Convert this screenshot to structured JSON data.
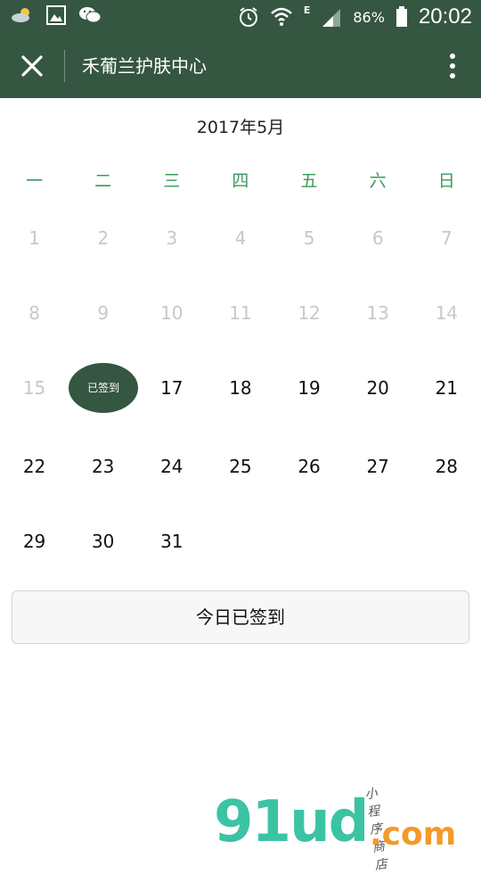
{
  "status_bar": {
    "battery_pct": "86%",
    "network_letter": "E",
    "time": "20:02",
    "icons": [
      "weather-icon",
      "gallery-icon",
      "wechat-icon",
      "alarm-icon",
      "wifi-icon",
      "signal-icon",
      "battery-icon"
    ]
  },
  "nav": {
    "title": "禾葡兰护肤中心",
    "icons": [
      "close-icon",
      "more-vertical-icon"
    ],
    "colors": {
      "bar": "#355641"
    }
  },
  "calendar": {
    "title": "2017年5月",
    "weekdays": [
      "一",
      "二",
      "三",
      "四",
      "五",
      "六",
      "日"
    ],
    "rows": [
      [
        {
          "d": "1",
          "past": true
        },
        {
          "d": "2",
          "past": true
        },
        {
          "d": "3",
          "past": true
        },
        {
          "d": "4",
          "past": true
        },
        {
          "d": "5",
          "past": true
        },
        {
          "d": "6",
          "past": true
        },
        {
          "d": "7",
          "past": true
        }
      ],
      [
        {
          "d": "8",
          "past": true
        },
        {
          "d": "9",
          "past": true
        },
        {
          "d": "10",
          "past": true
        },
        {
          "d": "11",
          "past": true
        },
        {
          "d": "12",
          "past": true
        },
        {
          "d": "13",
          "past": true
        },
        {
          "d": "14",
          "past": true
        }
      ],
      [
        {
          "d": "15",
          "past": true
        },
        {
          "d": "已签到",
          "signed": true
        },
        {
          "d": "17"
        },
        {
          "d": "18"
        },
        {
          "d": "19"
        },
        {
          "d": "20"
        },
        {
          "d": "21"
        }
      ],
      [
        {
          "d": "22"
        },
        {
          "d": "23"
        },
        {
          "d": "24"
        },
        {
          "d": "25"
        },
        {
          "d": "26"
        },
        {
          "d": "27"
        },
        {
          "d": "28"
        }
      ],
      [
        {
          "d": "29"
        },
        {
          "d": "30"
        },
        {
          "d": "31"
        }
      ]
    ],
    "colors": {
      "weekday": "#3a9a5a",
      "past": "#c8c8c8",
      "signed_bg": "#355641"
    }
  },
  "sign_button": {
    "label": "今日已签到"
  },
  "watermark": {
    "logo_text": "91ud",
    "domain": ".com",
    "tagline": "小程序商店"
  }
}
